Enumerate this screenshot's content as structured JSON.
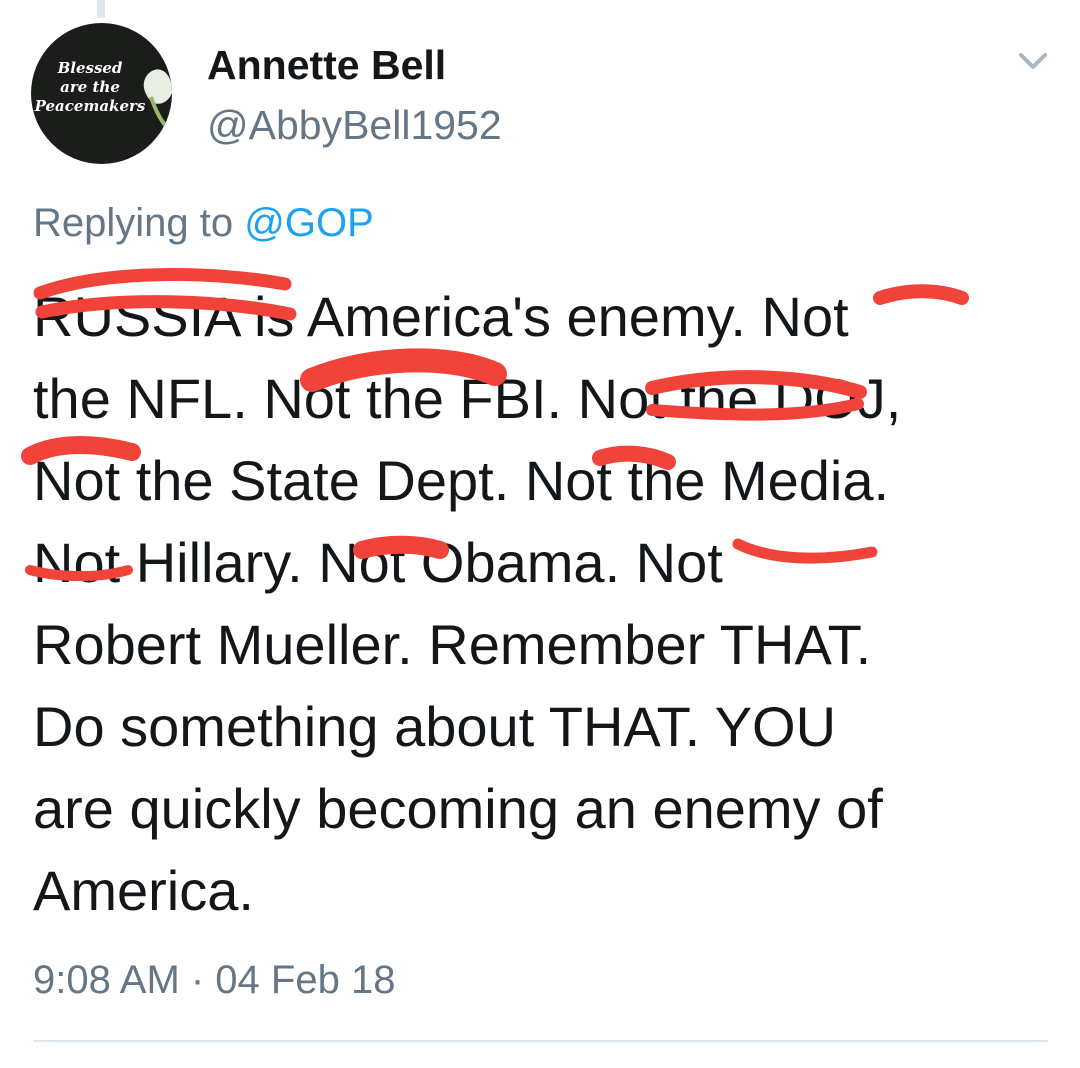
{
  "author": {
    "avatar_text": "Blessed\nare the\nPeacemakers",
    "display_name": "Annette Bell",
    "handle": "@AbbyBell1952"
  },
  "reply": {
    "prefix": "Replying to ",
    "mention": "@GOP"
  },
  "tweet": {
    "text": "RUSSIA is America's enemy. Not\nthe NFL. Not the FBI. Not the DOJ,\nNot the State Dept. Not the Media.\nNot Hillary. Not Obama. Not\nRobert Mueller. Remember THAT.\nDo something about THAT. YOU\nare quickly becoming an enemy of\nAmerica.",
    "timestamp": "9:08 AM · 04 Feb 18"
  },
  "icons": {
    "menu": "chevron-down-icon"
  },
  "colors": {
    "name": "#14171a",
    "secondary": "#657786",
    "link": "#1da1f2",
    "scribble": "#f0433a"
  }
}
